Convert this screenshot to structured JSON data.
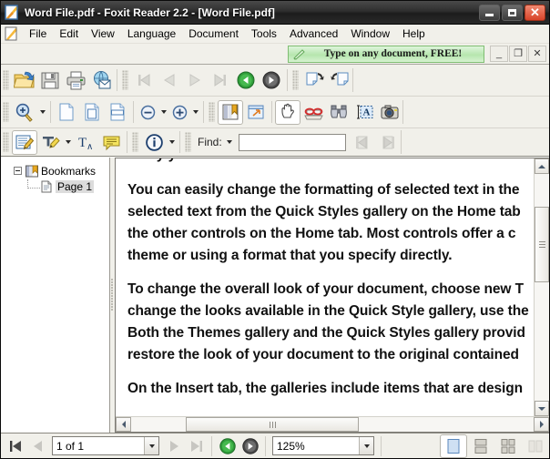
{
  "window": {
    "title": "Word File.pdf - Foxit Reader 2.2 - [Word File.pdf]",
    "app_icon": "foxit-document-icon",
    "minimize_label": "",
    "maximize_label": "",
    "close_label": "✕"
  },
  "menubar": {
    "doc_icon": "document-icon",
    "items": [
      {
        "label": "File"
      },
      {
        "label": "Edit"
      },
      {
        "label": "View"
      },
      {
        "label": "Language"
      },
      {
        "label": "Document"
      },
      {
        "label": "Tools"
      },
      {
        "label": "Advanced"
      },
      {
        "label": "Window"
      },
      {
        "label": "Help"
      }
    ]
  },
  "promo": {
    "text": "Type on any document, FREE!",
    "icon": "pen-cursor-icon",
    "bg_color": "#b6e6ae",
    "border_color": "#7fbd72"
  },
  "mdi_buttons": {
    "minimize": "_",
    "restore": "❐",
    "close": "✕"
  },
  "toolbar_file": {
    "buttons": [
      {
        "name": "open-file-button",
        "icon": "open-folder-icon",
        "disabled": false
      },
      {
        "name": "save-button",
        "icon": "floppy-disk-icon",
        "disabled": false
      },
      {
        "name": "print-button",
        "icon": "printer-icon",
        "disabled": false
      },
      {
        "name": "email-button",
        "icon": "globe-envelope-icon",
        "disabled": false
      }
    ],
    "nav_buttons": [
      {
        "name": "first-page-button",
        "icon": "first-page-icon",
        "disabled": true
      },
      {
        "name": "previous-page-button",
        "icon": "previous-page-icon",
        "disabled": true
      },
      {
        "name": "next-page-button",
        "icon": "next-page-icon",
        "disabled": true
      },
      {
        "name": "last-page-button",
        "icon": "last-page-icon",
        "disabled": true
      }
    ],
    "history_buttons": [
      {
        "name": "go-back-button",
        "icon": "green-back-arrow-icon",
        "disabled": false
      },
      {
        "name": "go-forward-button",
        "icon": "gray-forward-arrow-icon",
        "disabled": false
      }
    ],
    "rotate_buttons": [
      {
        "name": "rotate-clockwise-button",
        "icon": "rotate-clockwise-icon",
        "disabled": false
      },
      {
        "name": "rotate-counterclockwise-button",
        "icon": "rotate-counterclockwise-icon",
        "disabled": false
      }
    ]
  },
  "toolbar_view": {
    "zoom_tool": {
      "name": "zoom-tool-button",
      "icon": "magnifier-plus-icon"
    },
    "fit_buttons": [
      {
        "name": "actual-size-button",
        "icon": "page-actual-size-icon"
      },
      {
        "name": "fit-page-button",
        "icon": "page-fit-icon"
      },
      {
        "name": "fit-width-button",
        "icon": "page-fit-width-icon"
      }
    ],
    "zoom_out": {
      "name": "zoom-out-button",
      "icon": "minus-circle-icon"
    },
    "zoom_in": {
      "name": "zoom-in-button",
      "icon": "plus-circle-icon"
    },
    "panel_buttons": [
      {
        "name": "show-bookmarks-panel-button",
        "icon": "bookmarks-panel-icon",
        "active": true
      },
      {
        "name": "show-pages-panel-button",
        "icon": "pages-panel-icon",
        "active": false
      }
    ],
    "tools": [
      {
        "name": "hand-tool-button",
        "icon": "hand-icon",
        "active": true
      },
      {
        "name": "snapshot-read-button",
        "icon": "red-glasses-icon",
        "active": false
      },
      {
        "name": "find-tool-button",
        "icon": "binoculars-icon",
        "active": false
      },
      {
        "name": "select-text-button",
        "icon": "select-text-icon",
        "active": false
      },
      {
        "name": "snapshot-camera-button",
        "icon": "camera-icon",
        "active": false
      }
    ]
  },
  "toolbar_comment": {
    "buttons": [
      {
        "name": "typewriter-tool-button",
        "icon": "typewriter-pencil-icon",
        "active": true
      },
      {
        "name": "highlight-tool-button",
        "icon": "highlighter-icon",
        "active": false
      },
      {
        "name": "text-format-button",
        "icon": "text-subscript-icon",
        "active": false
      },
      {
        "name": "note-tool-button",
        "icon": "sticky-note-icon",
        "active": false
      },
      {
        "name": "document-info-button",
        "icon": "info-circle-icon",
        "active": false
      }
    ],
    "find": {
      "label": "Find:",
      "value": "",
      "placeholder": "",
      "previous_result": {
        "name": "find-previous-button",
        "icon": "find-previous-icon",
        "disabled": true
      },
      "next_result": {
        "name": "find-next-button",
        "icon": "find-next-icon",
        "disabled": true
      }
    }
  },
  "bookmarks_panel": {
    "root": {
      "label": "Bookmarks",
      "icon": "bookmarks-icon",
      "expanded": true
    },
    "children": [
      {
        "label": "Page 1",
        "icon": "page-icon",
        "selected": true
      }
    ]
  },
  "document": {
    "clipped_top_line": "many your controls on the Home tab.",
    "paragraphs": [
      [
        "You can easily change the formatting of selected text in the",
        "selected text from the Quick Styles gallery on the Home tab",
        "the other controls on the Home tab. Most controls offer a c",
        "theme or using a format that you specify directly."
      ],
      [
        "To change the overall look of your document, choose new T",
        "change the looks available in the Quick Style gallery, use the",
        "Both the Themes gallery and the Quick Styles gallery provid",
        "restore the look of your document to the original contained"
      ],
      [
        "On the Insert tab, the galleries include items that are design"
      ]
    ]
  },
  "statusbar": {
    "first_page_button": {
      "name": "status-first-page-button",
      "icon": "first-page-icon",
      "disabled": false
    },
    "previous_page_button": {
      "name": "status-previous-page-button",
      "icon": "previous-page-icon",
      "disabled": true
    },
    "page_value": "1 of 1",
    "next_page_button": {
      "name": "status-next-page-button",
      "icon": "next-page-icon",
      "disabled": true
    },
    "last_page_button": {
      "name": "status-last-page-button",
      "icon": "last-page-icon",
      "disabled": true
    },
    "go_back_button": {
      "name": "status-go-back-button",
      "icon": "green-back-arrow-icon"
    },
    "go_forward_button": {
      "name": "status-go-forward-button",
      "icon": "gray-forward-arrow-icon"
    },
    "zoom_value": "125%",
    "view_modes": [
      {
        "name": "single-page-view-button",
        "icon": "single-page-icon",
        "active": true,
        "disabled": false
      },
      {
        "name": "continuous-view-button",
        "icon": "continuous-page-icon",
        "active": false,
        "disabled": false
      },
      {
        "name": "continuous-facing-view-button",
        "icon": "continuous-facing-icon",
        "active": false,
        "disabled": false
      },
      {
        "name": "facing-view-button",
        "icon": "facing-page-icon",
        "active": false,
        "disabled": true
      }
    ]
  }
}
